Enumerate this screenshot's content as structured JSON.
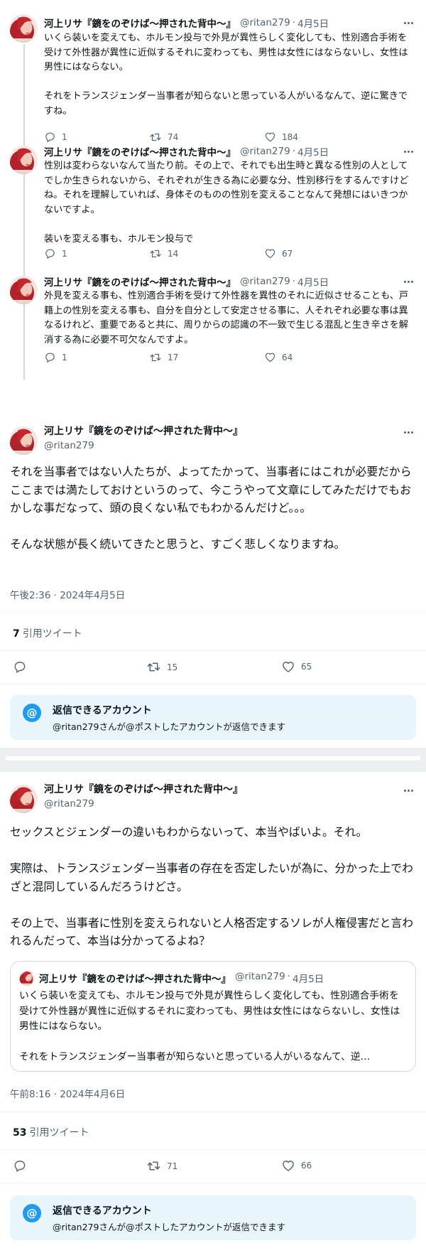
{
  "colors": {
    "accent": "#1d9bf0",
    "text": "#0f1419",
    "muted": "#536471",
    "reply_box_bg": "#e8f5fd"
  },
  "icons": [
    "reply-icon",
    "retweet-icon",
    "like-icon",
    "more-icon",
    "at-icon",
    "avatar"
  ],
  "thread": [
    {
      "name": "河上リサ『鏡をのぞけば〜押された背中〜』",
      "handle": "@ritan279",
      "dot": "·",
      "date": "4月5日",
      "body": "いくら装いを変えても、ホルモン投与で外見が異性らしく変化しても、性別適合手術を受けて外性器が異性に近似するそれに変わっても、男性は女性にはならないし、女性は男性にはならない。\n\nそれをトランスジェンダー当事者が知らないと思っている人がいるなんて、逆に驚きですね。",
      "replies": "1",
      "retweets": "74",
      "likes": "184"
    },
    {
      "name": "河上リサ『鏡をのぞけば〜押された背中〜』",
      "handle": "@ritan279",
      "dot": "·",
      "date": "4月5日",
      "body": "性別は変わらないなんて当たり前。その上で、それでも出生時と異なる性別の人としてでしか生きられないから、それぞれが生きる為に必要な分、性別移行をするんですけどね。それを理解していれば、身体そのものの性別を変えることなんて発想にはいきつかないですよ。\n\n装いを変える事も、ホルモン投与で",
      "replies": "1",
      "retweets": "14",
      "likes": "67"
    },
    {
      "name": "河上リサ『鏡をのぞけば〜押された背中〜』",
      "handle": "@ritan279",
      "dot": "·",
      "date": "4月5日",
      "body": "外見を変える事も、性別適合手術を受けて外性器を異性のそれに近似させることも、戸籍上の性別を変える事も、自分を自分として安定させる事に、人それぞれ必要な事は異なるけれど、重要であると共に、周りからの認識の不一致で生じる混乱と生き辛さを解消する為に必要不可欠なんですよ。",
      "replies": "1",
      "retweets": "17",
      "likes": "64"
    }
  ],
  "main1": {
    "name": "河上リサ『鏡をのぞけば〜押された背中〜』",
    "handle": "@ritan279",
    "body": "それを当事者ではない人たちが、よってたかって、当事者にはこれが必要だからここまでは満たしておけというのって、今こうやって文章にしてみただけでもおかしな事だなって、頭の良くない私でもわかるんだけど。。。\n\nそんな状態が長く続いてきたと思うと、すごく悲しくなりますね。",
    "timestamp": "午後2:36 · 2024年4月5日",
    "quote_count": "7",
    "quote_label": "引用ツイート",
    "retweets": "15",
    "likes": "65",
    "reply_title": "返信できるアカウント",
    "reply_sub": "@ritan279さんが@ポストしたアカウントが返信できます"
  },
  "main2": {
    "name": "河上リサ『鏡をのぞけば〜押された背中〜』",
    "handle": "@ritan279",
    "body": "セックスとジェンダーの違いもわからないって、本当やばいよ。それ。\n\n実際は、トランスジェンダー当事者の存在を否定したいが為に、分かった上でわざと混同しているんだろうけどさ。\n\nその上で、当事者に性別を変えられないと人格否定するソレが人権侵害だと言われるんだって、本当は分かってるよね？",
    "quoted": {
      "name": "河上リサ『鏡をのぞけば〜押された背中〜』",
      "handle": "@ritan279",
      "dot": "·",
      "date": "4月5日",
      "body": "いくら装いを変えても、ホルモン投与で外見が異性らしく変化しても、性別適合手術を受けて外性器が異性に近似するそれに変わっても、男性は女性にはならないし、女性は男性にはならない。\n\nそれをトランスジェンダー当事者が知らないと思っている人がいるなんて、逆…"
    },
    "timestamp": "午前8:16 · 2024年4月6日",
    "quote_count": "53",
    "quote_label": "引用ツイート",
    "retweets": "71",
    "likes": "66",
    "reply_title": "返信できるアカウント",
    "reply_sub": "@ritan279さんが@ポストしたアカウントが返信できます"
  }
}
